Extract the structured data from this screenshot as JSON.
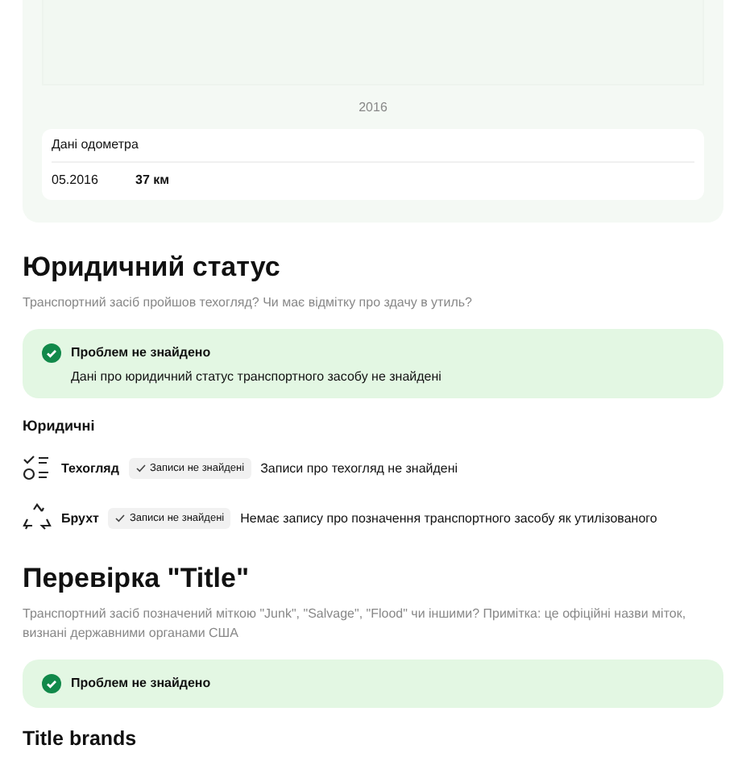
{
  "odometer_panel": {
    "axis_label": "2016",
    "card_title": "Дані одометра",
    "readings": [
      {
        "date": "05.2016",
        "value": "37 км"
      }
    ]
  },
  "legal_status": {
    "heading": "Юридичний статус",
    "subtitle": "Транспортний засіб пройшов техогляд? Чи має відмітку про здачу в утиль?",
    "alert": {
      "title": "Проблем не знайдено",
      "text": "Дані про юридичний статус транспортного засобу не знайдені"
    },
    "group_title": "Юридичні",
    "records": [
      {
        "kind": "inspection",
        "name": "Техогляд",
        "badge": "Записи не знайдені",
        "text": "Записи про техогляд не знайдені"
      },
      {
        "kind": "scrap",
        "name": "Брухт",
        "badge": "Записи не знайдені",
        "text": "Немає запису про позначення транспортного засобу як утилізованого"
      }
    ]
  },
  "title_check": {
    "heading": "Перевірка \"Title\"",
    "subtitle": "Транспортний засіб позначений міткою \"Junk\", \"Salvage\", \"Flood\" чи іншими? Примітка: це офіційні назви міток, визнані державними органами США",
    "alert": {
      "title": "Проблем не знайдено"
    },
    "subheading": "Title brands"
  }
}
